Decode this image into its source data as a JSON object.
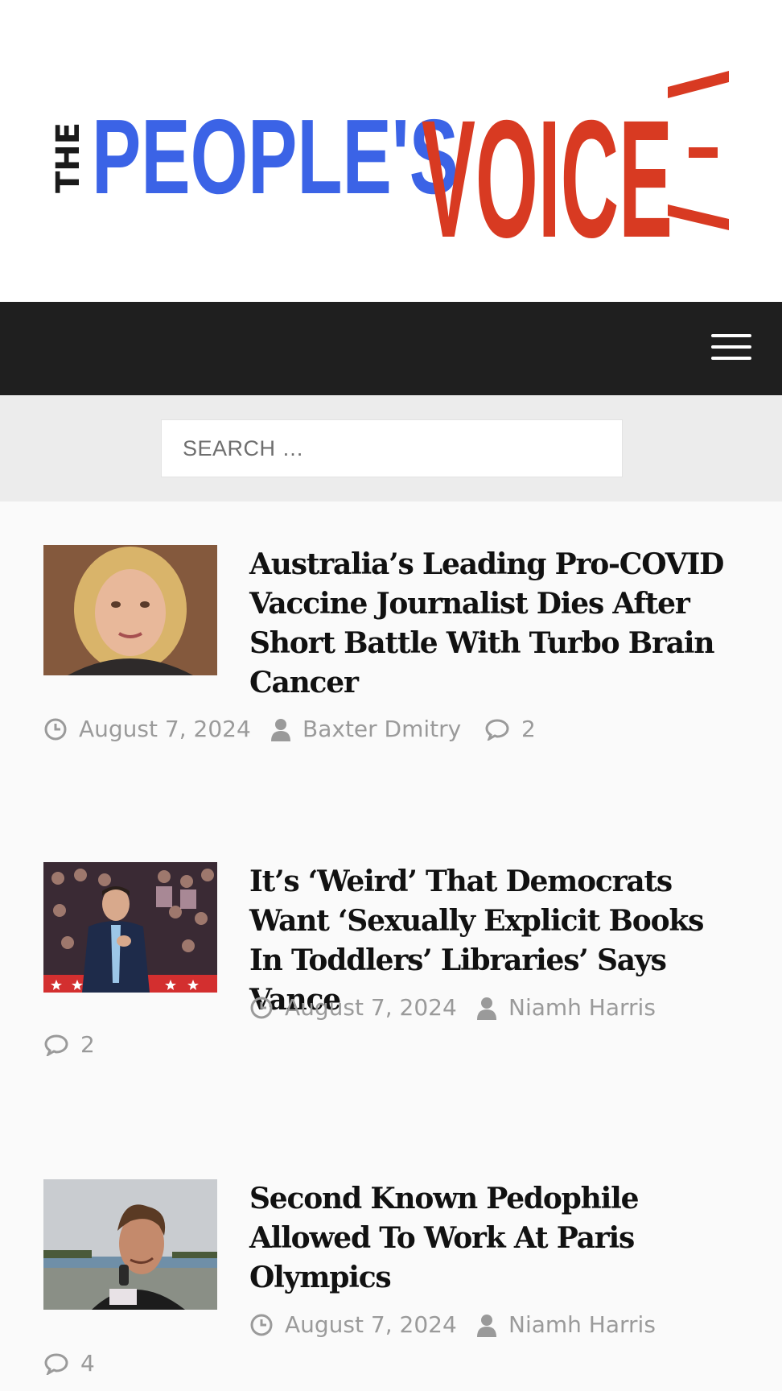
{
  "site": {
    "logo_the": "THE",
    "logo_peoples": "PEOPLE'S",
    "logo_voice": "VOICE"
  },
  "nav": {
    "menu_icon": "hamburger-icon"
  },
  "search": {
    "placeholder": "SEARCH …"
  },
  "articles": [
    {
      "title": "Australia’s Leading Pro-COVID Vaccine Journalist Dies After Short Battle With Turbo Brain Cancer",
      "date": "August 7, 2024",
      "author": "Baxter Dmitry",
      "comments": "2"
    },
    {
      "title": "It’s ‘Weird’ That Democrats Want ‘Sexually Explicit Books In Toddlers’ Libraries’ Says Vance",
      "date": "August 7, 2024",
      "author": "Niamh Harris",
      "comments": "2"
    },
    {
      "title": "Second Known Pedophile Allowed To Work At Paris Olympics",
      "date": "August 7, 2024",
      "author": "Niamh Harris",
      "comments": "4"
    }
  ],
  "icons": {
    "date": "clock-icon",
    "author": "user-icon",
    "comments": "comment-icon"
  },
  "colors": {
    "logo_blue": "#3b63e6",
    "logo_red": "#d83a22",
    "nav_bg": "#1f1f1f",
    "meta_gray": "#9a9a9a"
  }
}
